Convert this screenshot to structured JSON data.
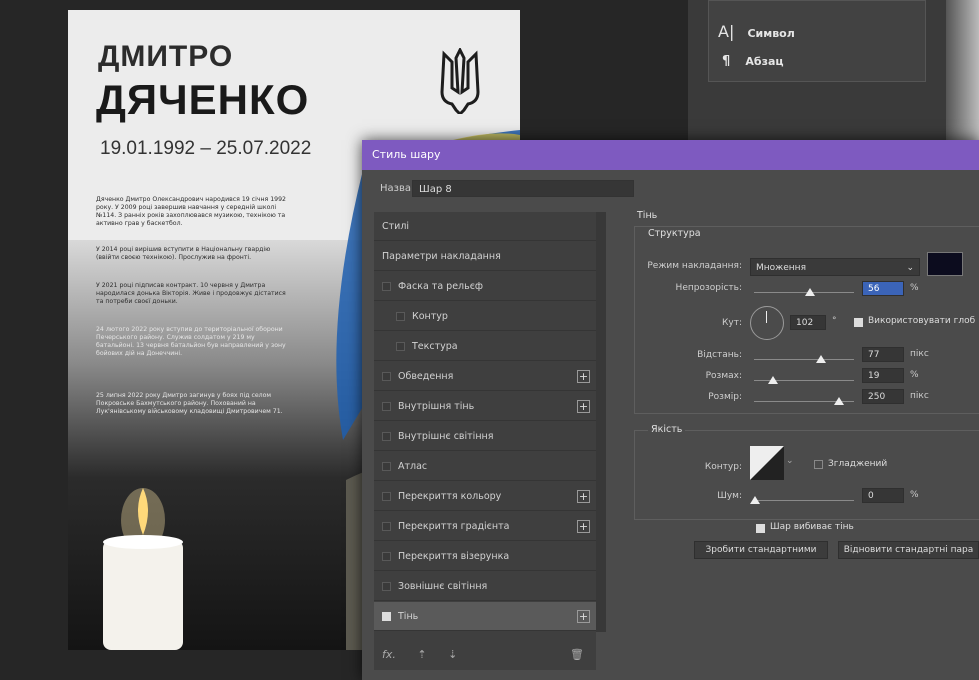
{
  "poster": {
    "first_name": "ДМИТРО",
    "last_name": "ДЯЧЕНКО",
    "dates": "19.01.1992 – 25.07.2022",
    "bio": [
      "Дяченко Дмитро Олександрович народився 19 січня 1992 року. У 2009 році завершив навчання у середній школі №114. З ранніх років захоплювався музикою, технікою та активно грав у баскетбол.",
      "У 2014 році вирішив вступити в Національну гвардію (ввійти своєю технікою). Прослужив на фронті.",
      "У 2021 році підписав контракт. 10 червня у Дмитра народилася донька Вікторія. Живе і продовжує дістатися та потреби своєї доньки.",
      "24 лютого 2022 року вступив до територіальної оборони Печерського району. Служив солдатом у 219 му батальйоні. 13 червня батальйон був направлений у зону бойових дій на Донеччині.",
      "25 липня 2022 року Дмитро загинув у боях під селом Покровське Бахмутського району. Похований на Лук'янівському військовому кладовищі Дмитровичем 71."
    ]
  },
  "right_panel": {
    "items": [
      {
        "icon": "character-icon",
        "label": "Символ"
      },
      {
        "icon": "paragraph-icon",
        "label": "Абзац"
      }
    ]
  },
  "dialog": {
    "title": "Стиль шару",
    "name_label": "Назва:",
    "name_value": "Шар 8",
    "styles": [
      {
        "label": "Стилі",
        "plain": true
      },
      {
        "label": "Параметри накладання",
        "plain": true
      },
      {
        "label": "Фаска та рельєф",
        "checked": false
      },
      {
        "label": "Контур",
        "checked": false,
        "sub": true
      },
      {
        "label": "Текстура",
        "checked": false,
        "sub": true
      },
      {
        "label": "Обведення",
        "checked": false,
        "plus": true
      },
      {
        "label": "Внутрішня тінь",
        "checked": false,
        "plus": true
      },
      {
        "label": "Внутрішнє світіння",
        "checked": false
      },
      {
        "label": "Атлас",
        "checked": false
      },
      {
        "label": "Перекриття кольору",
        "checked": false,
        "plus": true
      },
      {
        "label": "Перекриття градієнта",
        "checked": false,
        "plus": true
      },
      {
        "label": "Перекриття візерунка",
        "checked": false
      },
      {
        "label": "Зовнішнє світіння",
        "checked": false
      },
      {
        "label": "Тінь",
        "checked": true,
        "plus": true,
        "selected": true
      }
    ],
    "footer_icons": [
      "fx-icon",
      "up-arrow-icon",
      "down-arrow-icon",
      "trash-icon"
    ],
    "settings": {
      "section": "Тінь",
      "structure_title": "Структура",
      "blend_mode_label": "Режим накладання:",
      "blend_mode_value": "Множення",
      "blend_color": "#0c0c1e",
      "opacity_label": "Непрозорість:",
      "opacity_value": "56",
      "opacity_unit": "%",
      "opacity": 0.56,
      "angle_label": "Кут:",
      "angle_value": "102",
      "angle_unit": "°",
      "global_light_label": "Використовувати глоб",
      "distance_label": "Відстань:",
      "distance_value": "77",
      "distance_unit": "пікс",
      "spread_label": "Розмах:",
      "spread_value": "19",
      "spread_unit": "%",
      "size_label": "Розмір:",
      "size_value": "250",
      "size_unit": "пікс",
      "quality_title": "Якість",
      "contour_label": "Контур:",
      "antialias_label": "Згладжений",
      "noise_label": "Шум:",
      "noise_value": "0",
      "noise_unit": "%",
      "knockout_label": "Шар вибиває тінь",
      "make_default": "Зробити стандартними",
      "reset_default": "Відновити стандартні пара"
    }
  }
}
